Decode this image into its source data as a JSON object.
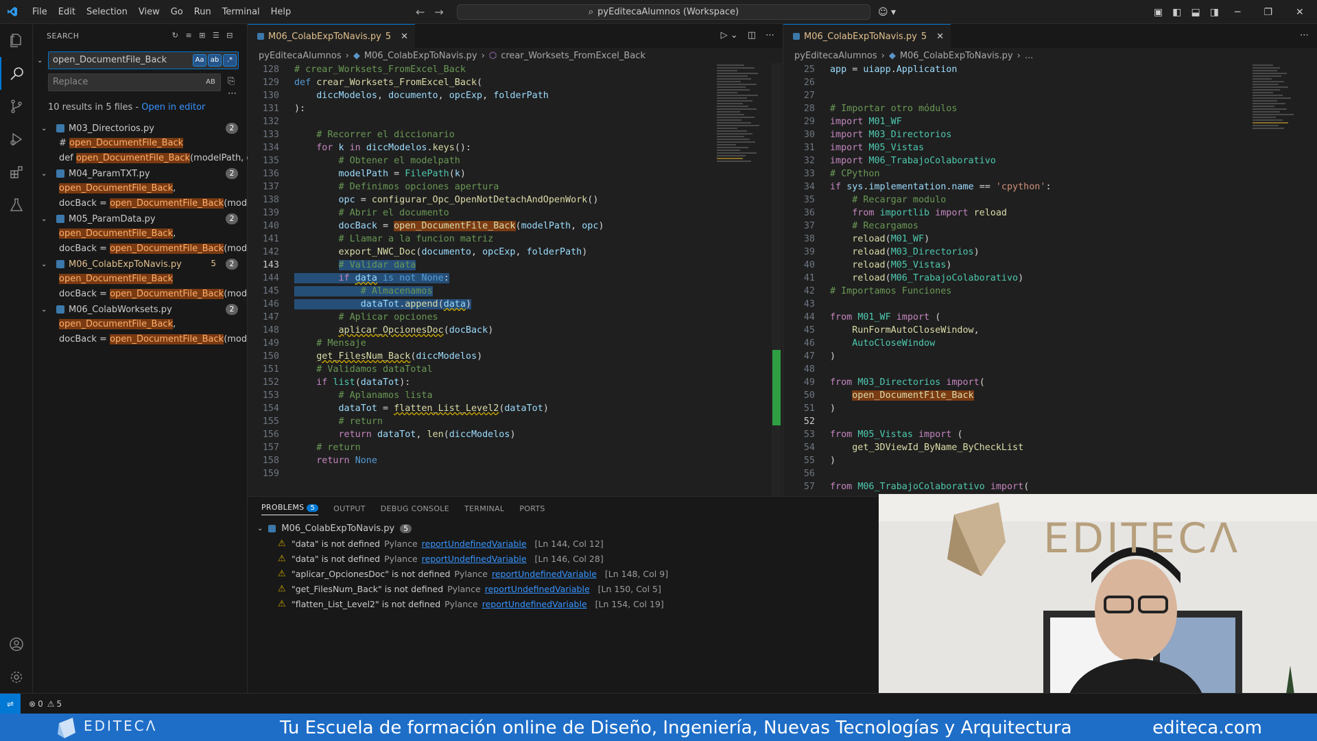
{
  "titlebar": {
    "menu": [
      "File",
      "Edit",
      "Selection",
      "View",
      "Go",
      "Run",
      "Terminal",
      "Help"
    ],
    "command_center": "pyEditecaAlumnos (Workspace)"
  },
  "sidebar": {
    "title": "SEARCH",
    "search_value": "open_DocumentFile_Back",
    "replace_placeholder": "Replace",
    "opt_case": "Aa",
    "opt_word": "ab",
    "opt_regex": ".*",
    "opt_preserve": "AB",
    "summary": "10 results in 5 files - ",
    "open_in_editor": "Open in editor",
    "files": [
      {
        "name": "M03_Directorios.py",
        "count": "2",
        "modified": "",
        "matches": [
          {
            "pre": "# ",
            "hit": "open_DocumentFile_Back",
            "post": ""
          },
          {
            "pre": "def ",
            "hit": "open_DocumentFile_Back",
            "post": "(modelPath, opc):"
          }
        ]
      },
      {
        "name": "M04_ParamTXT.py",
        "count": "2",
        "modified": "",
        "matches": [
          {
            "pre": "",
            "hit": "open_DocumentFile_Back",
            "post": ","
          },
          {
            "pre": "docBack = ",
            "hit": "open_DocumentFile_Back",
            "post": "(modelPa..."
          }
        ]
      },
      {
        "name": "M05_ParamData.py",
        "count": "2",
        "modified": "",
        "matches": [
          {
            "pre": "",
            "hit": "open_DocumentFile_Back",
            "post": ","
          },
          {
            "pre": "docBack = ",
            "hit": "open_DocumentFile_Back",
            "post": "(modelPa..."
          }
        ]
      },
      {
        "name": "M06_ColabExpToNavis.py",
        "count": "2",
        "modified": "5",
        "matches": [
          {
            "pre": "",
            "hit": "open_DocumentFile_Back",
            "post": ""
          },
          {
            "pre": "docBack = ",
            "hit": "open_DocumentFile_Back",
            "post": "(modelPa..."
          }
        ]
      },
      {
        "name": "M06_ColabWorksets.py",
        "count": "2",
        "modified": "",
        "matches": [
          {
            "pre": "",
            "hit": "open_DocumentFile_Back",
            "post": ","
          },
          {
            "pre": "docBack = ",
            "hit": "open_DocumentFile_Back",
            "post": "(modelPa..."
          }
        ]
      }
    ]
  },
  "editor1": {
    "tab_label": "M06_ColabExpToNavis.py",
    "tab_badge": "5",
    "breadcrumb": [
      "pyEditecaAlumnos",
      "M06_ColabExpToNavis.py",
      "crear_Worksets_FromExcel_Back"
    ]
  },
  "editor2": {
    "tab_label": "M06_ColabExpToNavis.py",
    "tab_badge": "5",
    "breadcrumb": [
      "pyEditecaAlumnos",
      "M06_ColabExpToNavis.py",
      "..."
    ]
  },
  "panel": {
    "tabs": [
      "PROBLEMS",
      "OUTPUT",
      "DEBUG CONSOLE",
      "TERMINAL",
      "PORTS"
    ],
    "problems_badge": "5",
    "file": "M06_ColabExpToNavis.py",
    "file_count": "5",
    "problems": [
      {
        "msg": "\"data\" is not defined",
        "src": "Pylance",
        "code": "reportUndefinedVariable",
        "pos": "[Ln 144, Col 12]"
      },
      {
        "msg": "\"data\" is not defined",
        "src": "Pylance",
        "code": "reportUndefinedVariable",
        "pos": "[Ln 146, Col 28]"
      },
      {
        "msg": "\"aplicar_OpcionesDoc\" is not defined",
        "src": "Pylance",
        "code": "reportUndefinedVariable",
        "pos": "[Ln 148, Col 9]"
      },
      {
        "msg": "\"get_FilesNum_Back\" is not defined",
        "src": "Pylance",
        "code": "reportUndefinedVariable",
        "pos": "[Ln 150, Col 5]"
      },
      {
        "msg": "\"flatten_List_Level2\" is not defined",
        "src": "Pylance",
        "code": "reportUndefinedVariable",
        "pos": "[Ln 154, Col 19]"
      }
    ]
  },
  "statusbar": {
    "errors": "0",
    "warnings": "5"
  },
  "webcam": {
    "wall_text": "EDITECΛ"
  },
  "banner": {
    "brand": "EDITECΛ",
    "tagline": "Tu Escuela de formación online de Diseño, Ingeniería, Nuevas Tecnologías y Arquitectura",
    "site": "editeca.com"
  },
  "icons": {
    "activity": [
      "explorer-icon",
      "search-icon",
      "source-control-icon",
      "run-debug-icon",
      "extensions-icon",
      "testing-icon"
    ],
    "accent": "#0078d4"
  }
}
